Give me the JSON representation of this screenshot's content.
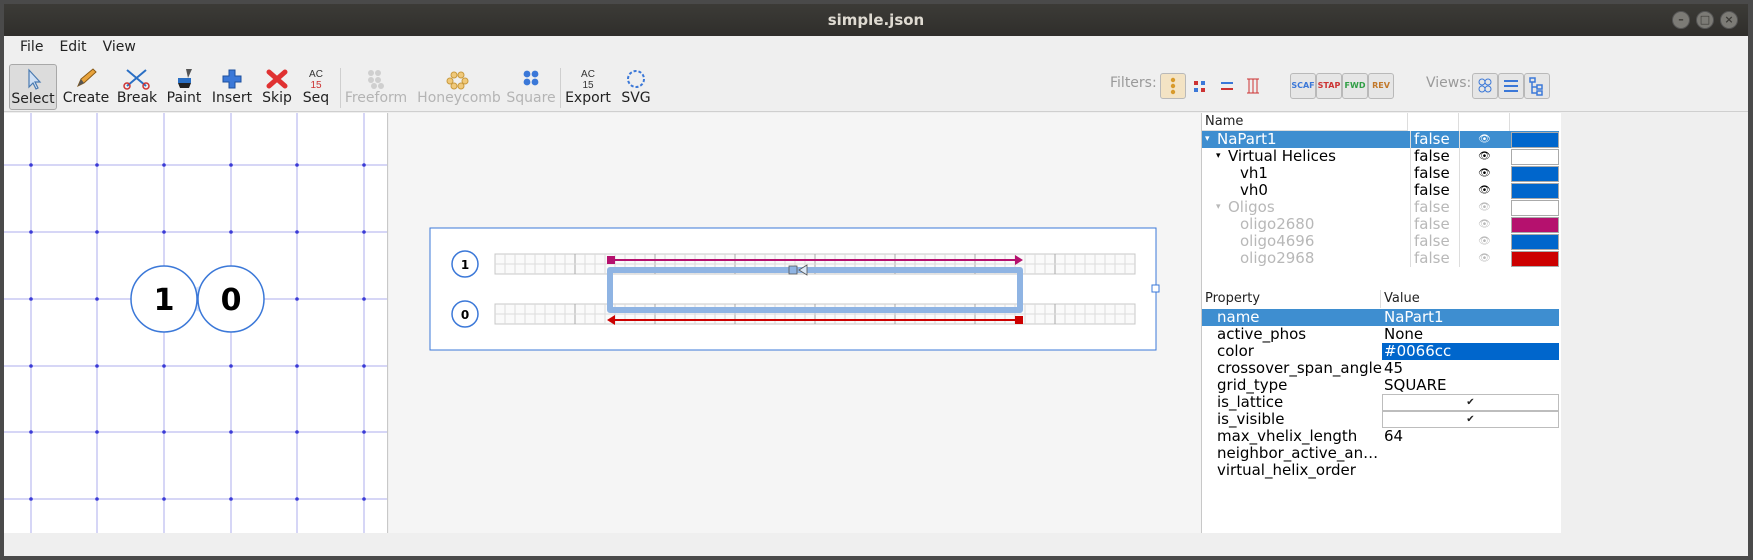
{
  "window": {
    "title": "simple.json"
  },
  "menu": [
    "File",
    "Edit",
    "View"
  ],
  "toolbar": {
    "tools": {
      "select": "Select",
      "create": "Create",
      "break": "Break",
      "paint": "Paint",
      "insert": "Insert",
      "skip": "Skip",
      "seq": "Seq",
      "freeform": "Freeform",
      "honeycomb": "Honeycomb",
      "square": "Square",
      "export": "Export",
      "svg": "SVG"
    },
    "filters_label": "Filters:",
    "views_label": "Views:",
    "filter_buttons": [
      "SCAF",
      "STAP",
      "FWD",
      "REV"
    ],
    "seq_icon_text": "AC 15"
  },
  "slice_view": {
    "helix_labels": [
      "1",
      "0"
    ]
  },
  "path_view": {
    "helix_labels": [
      "1",
      "0"
    ]
  },
  "tree": {
    "header_name": "Name",
    "rows": [
      {
        "name": "NaPart1",
        "value": "false",
        "color": "#0066cc"
      },
      {
        "name": "Virtual Helices",
        "value": "false",
        "color": "#ffffff"
      },
      {
        "name": "vh1",
        "value": "false",
        "color": "#0066cc"
      },
      {
        "name": "vh0",
        "value": "false",
        "color": "#0066cc"
      },
      {
        "name": "Oligos",
        "value": "false",
        "color": "#ffffff"
      },
      {
        "name": "oligo2680",
        "value": "false",
        "color": "#b5116e"
      },
      {
        "name": "oligo4696",
        "value": "false",
        "color": "#0066cc"
      },
      {
        "name": "oligo2968",
        "value": "false",
        "color": "#cc0000"
      }
    ]
  },
  "properties": {
    "header_property": "Property",
    "header_value": "Value",
    "rows": [
      {
        "name": "name",
        "value": "NaPart1"
      },
      {
        "name": "active_phos",
        "value": "None"
      },
      {
        "name": "color",
        "value": "#0066cc"
      },
      {
        "name": "crossover_span_angle",
        "value": "45"
      },
      {
        "name": "grid_type",
        "value": "SQUARE"
      },
      {
        "name": "is_lattice",
        "value": "✔"
      },
      {
        "name": "is_visible",
        "value": "✔"
      },
      {
        "name": "max_vhelix_length",
        "value": "64"
      },
      {
        "name": "neighbor_active_an…",
        "value": ""
      },
      {
        "name": "virtual_helix_order",
        "value": ""
      }
    ]
  },
  "colors": {
    "selection": "#3e8ed0",
    "scaffold": "#0066cc",
    "staple_red": "#cc0000",
    "staple_magenta": "#b5116e"
  },
  "eye_icon": "👁"
}
